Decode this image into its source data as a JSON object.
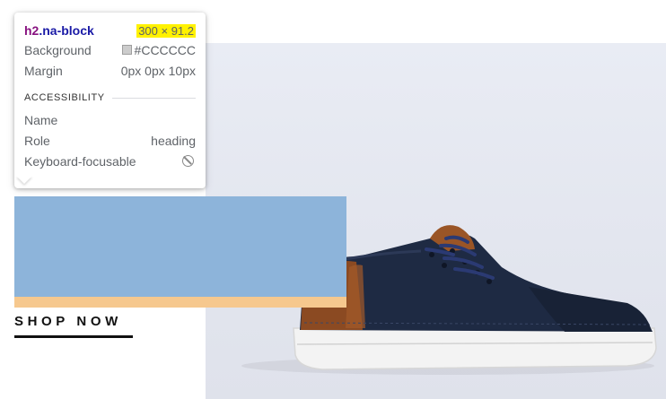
{
  "tooltip": {
    "tag": "h2",
    "class_name": ".na-block",
    "size": "300 × 91.2",
    "rows": [
      {
        "label": "Background",
        "value": "#CCCCCC"
      },
      {
        "label": "Margin",
        "value": "0px 0px 10px"
      }
    ],
    "accessibility_heading": "ACCESSIBILITY",
    "a11y": {
      "name_label": "Name",
      "name_value": "",
      "role_label": "Role",
      "role_value": "heading",
      "focusable_label": "Keyboard-focusable",
      "focusable_icon": "not-allowed-icon"
    }
  },
  "colors": {
    "swatch": "#CCCCCC",
    "highlight_content": "#8db4da",
    "highlight_margin": "#f6c88e",
    "size_badge": "#fff200"
  },
  "link": {
    "shop_now": "SHOP NOW"
  },
  "product": {
    "image_icon": "sneaker-image"
  }
}
